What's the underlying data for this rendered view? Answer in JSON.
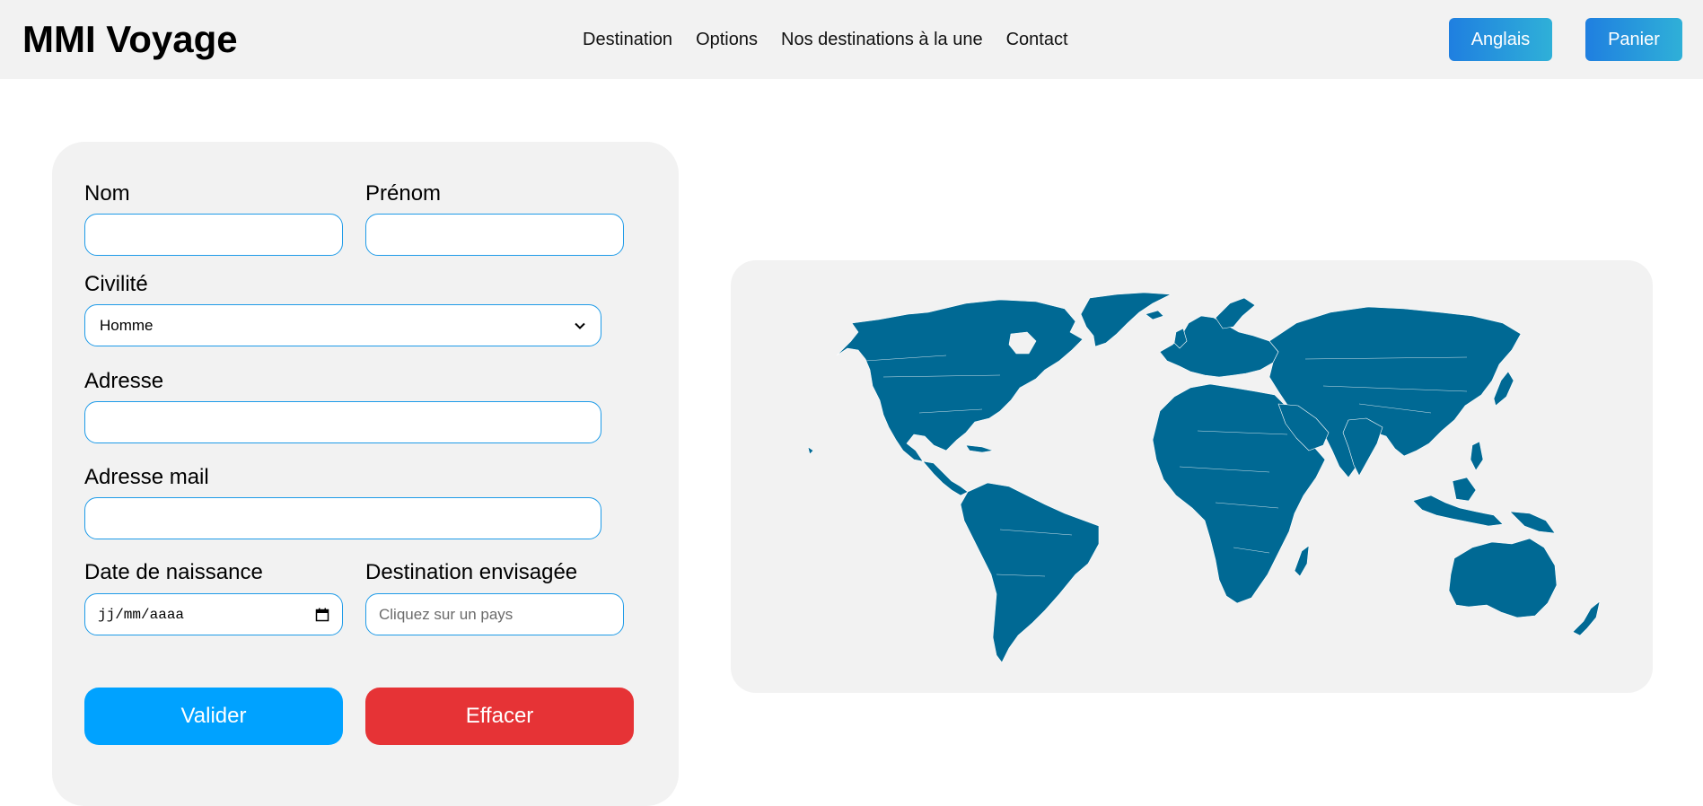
{
  "header": {
    "logo": "MMI Voyage",
    "nav": [
      {
        "label": "Destination"
      },
      {
        "label": "Options"
      },
      {
        "label": "Nos destinations à la une"
      },
      {
        "label": "Contact"
      }
    ],
    "language_button": "Anglais",
    "cart_button": "Panier"
  },
  "form": {
    "nom_label": "Nom",
    "prenom_label": "Prénom",
    "civilite_label": "Civilité",
    "civilite_value": "Homme",
    "adresse_label": "Adresse",
    "email_label": "Adresse mail",
    "birthdate_label": "Date de naissance",
    "birthdate_placeholder": "jj/mm/aaaa",
    "destination_label": "Destination envisagée",
    "destination_placeholder": "Cliquez sur un pays",
    "submit_label": "Valider",
    "clear_label": "Effacer"
  },
  "colors": {
    "accent_blue": "#00a2ff",
    "danger_red": "#e63336",
    "map_fill": "#006994",
    "panel_bg": "#f2f2f2"
  }
}
